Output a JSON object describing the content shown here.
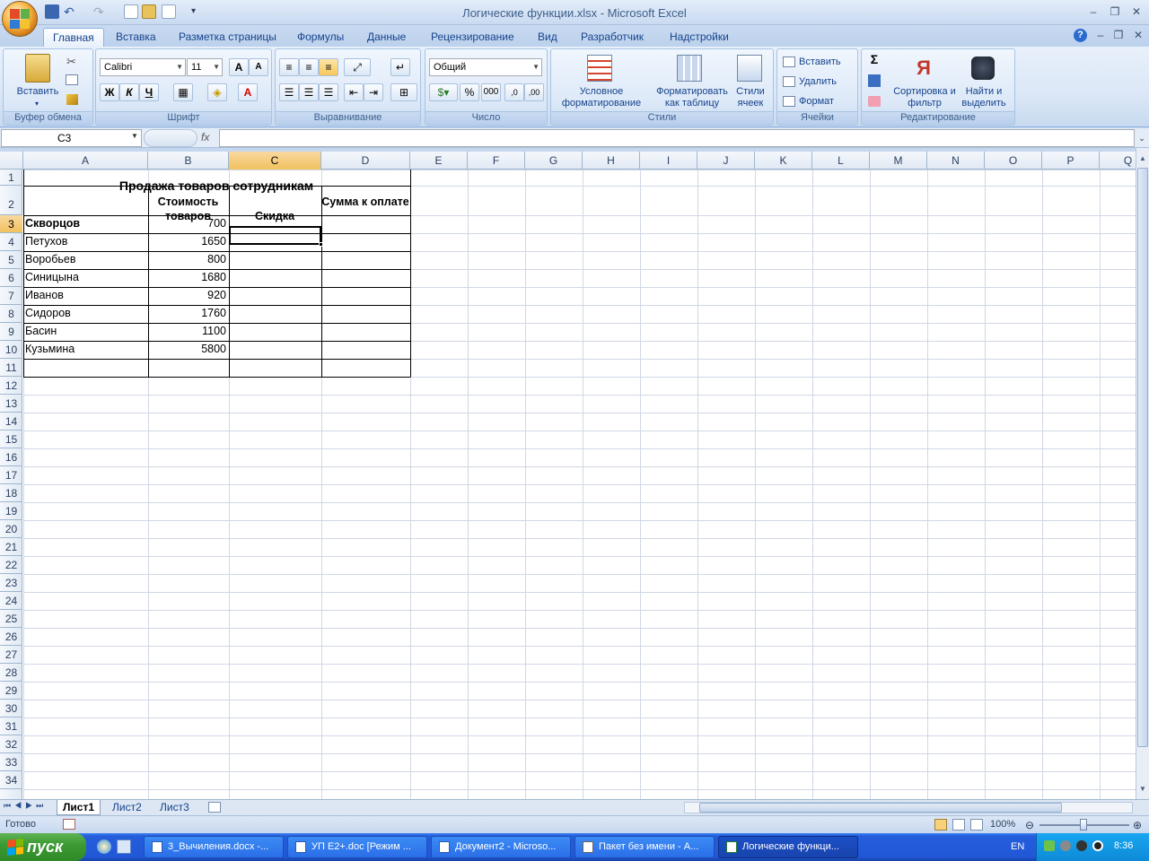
{
  "window": {
    "title": "Логические функции.xlsx - Microsoft Excel"
  },
  "ribbon_tabs": [
    "Главная",
    "Вставка",
    "Разметка страницы",
    "Формулы",
    "Данные",
    "Рецензирование",
    "Вид",
    "Разработчик",
    "Надстройки"
  ],
  "ribbon": {
    "clipboard": {
      "label": "Буфер обмена",
      "paste": "Вставить"
    },
    "font": {
      "label": "Шрифт",
      "name": "Calibri",
      "size": "11",
      "bold": "Ж",
      "italic": "К",
      "underline": "Ч",
      "grow": "A",
      "shrink": "A",
      "color_letter": "A"
    },
    "alignment": {
      "label": "Выравнивание"
    },
    "number": {
      "label": "Число",
      "format": "Общий",
      "percent": "%",
      "thousands": "000"
    },
    "styles": {
      "label": "Стили",
      "conditional": "Условное форматирование",
      "table": "Форматировать как таблицу",
      "cell_styles": "Стили ячеек"
    },
    "cells": {
      "label": "Ячейки",
      "insert": "Вставить",
      "delete": "Удалить",
      "format": "Формат"
    },
    "editing": {
      "label": "Редактирование",
      "sigma": "Σ",
      "sort": "Сортировка и фильтр",
      "find": "Найти и выделить"
    }
  },
  "formula_bar": {
    "name_box": "C3",
    "fx": "fx",
    "formula": ""
  },
  "columns": [
    "A",
    "B",
    "C",
    "D",
    "E",
    "F",
    "G",
    "H",
    "I",
    "J",
    "K",
    "L",
    "M",
    "N",
    "O",
    "P",
    "Q"
  ],
  "rows": [
    "1",
    "2",
    "3",
    "4",
    "5",
    "6",
    "7",
    "8",
    "9",
    "10",
    "11",
    "12",
    "13",
    "14",
    "15",
    "16",
    "17",
    "18",
    "19",
    "20",
    "21",
    "22",
    "23",
    "24",
    "25",
    "26",
    "27",
    "28",
    "29",
    "30",
    "31",
    "32",
    "33",
    "34"
  ],
  "sheet": {
    "title": "Продажа товаров сотрудникам",
    "header_b": "Стоимость товаров",
    "header_c": "Скидка",
    "header_d": "Сумма к оплате",
    "data": [
      {
        "name": "Скворцов",
        "value": "700"
      },
      {
        "name": "Петухов",
        "value": "1650"
      },
      {
        "name": "Воробьев",
        "value": "800"
      },
      {
        "name": "Синицына",
        "value": "1680"
      },
      {
        "name": "Иванов",
        "value": "920"
      },
      {
        "name": "Сидоров",
        "value": "1760"
      },
      {
        "name": "Басин",
        "value": "1100"
      },
      {
        "name": "Кузьмина",
        "value": "5800"
      }
    ]
  },
  "sheet_tabs": [
    "Лист1",
    "Лист2",
    "Лист3"
  ],
  "status": {
    "ready": "Готово",
    "zoom": "100%"
  },
  "taskbar": {
    "start": "пуск",
    "items": [
      "3_Вычиления.docx -...",
      "УП Е2+.doc [Режим ...",
      "Документ2 - Microso...",
      "Пакет без имени - А...",
      "Логические функци..."
    ],
    "lang": "EN",
    "clock": "8:36"
  }
}
